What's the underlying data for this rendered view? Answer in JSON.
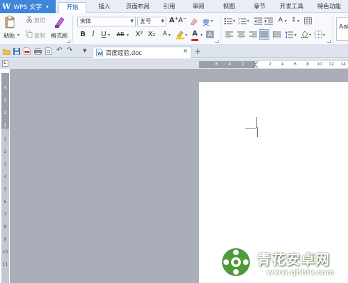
{
  "app": {
    "logo": "W",
    "name": "WPS 文字",
    "menu_arrow": "▾"
  },
  "tabs": [
    "开始",
    "插入",
    "页面布局",
    "引用",
    "审阅",
    "视图",
    "章节",
    "开发工具",
    "特色功能"
  ],
  "ribbon": {
    "paste": "粘贴",
    "cut": "剪切",
    "copy": "复制",
    "format_painter": "格式刷",
    "font_name": "宋体",
    "font_size": "五号",
    "font_grow": "A⁺",
    "font_shrink": "A⁻",
    "bold": "B",
    "italic": "I",
    "underline": "U",
    "strikethrough": "AB",
    "superscript": "X²",
    "subscript": "X₂",
    "font_color": "A",
    "char_shading": "A",
    "style_preview": "AaB"
  },
  "document": {
    "tab_title": "百度经验.doc",
    "close": "×",
    "new_tab": "+"
  },
  "rulers": {
    "horizontal": [
      "6",
      "4",
      "2",
      "2",
      "4",
      "6",
      "8",
      "10",
      "12",
      "14",
      "16"
    ],
    "vertical": [
      "4",
      "3",
      "2",
      "1",
      "1",
      "2",
      "3",
      "4",
      "5",
      "6",
      "7",
      "8",
      "9",
      "10",
      "11",
      "12",
      "13",
      "14"
    ]
  },
  "watermark": {
    "title": "青花安卓网",
    "url": "www.qhhlv.com"
  },
  "colors": {
    "app_button": "#3d86d8",
    "active_tab_text": "#1d5fb0",
    "workspace": "#a9aeb8",
    "font_color_bar": "#e02020",
    "highlight_bar": "#f2d01a"
  }
}
